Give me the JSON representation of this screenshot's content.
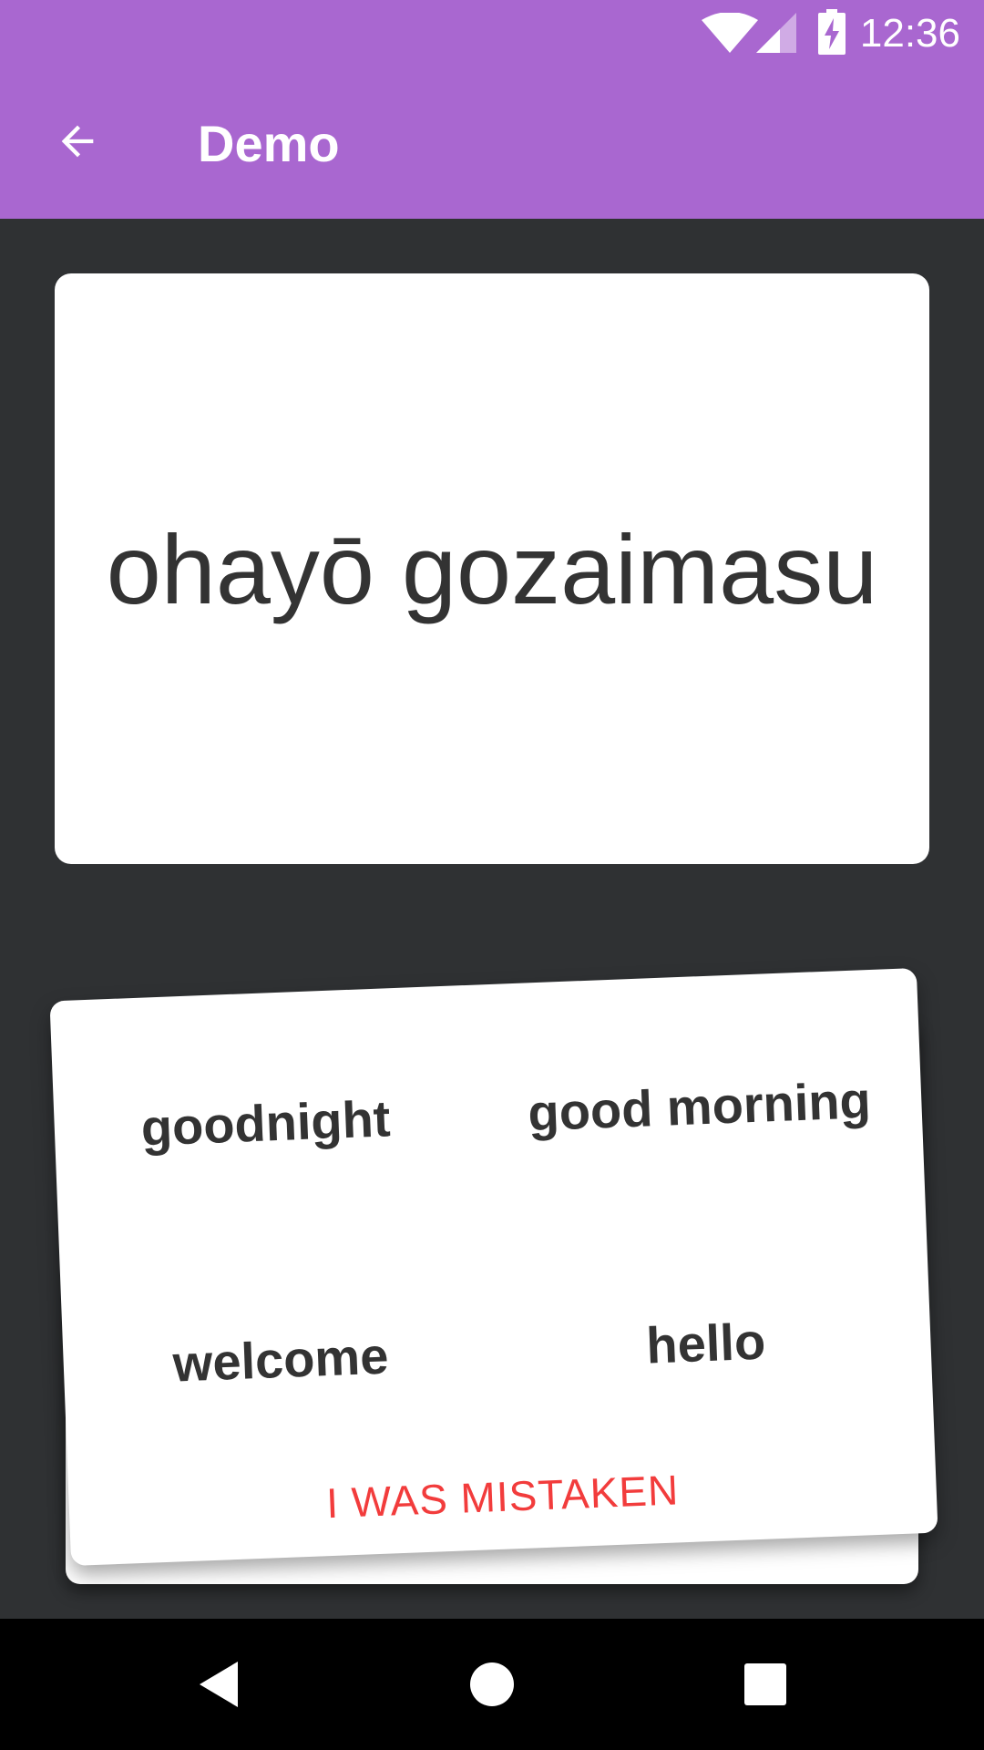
{
  "status_bar": {
    "time": "12:36",
    "icons": [
      "wifi-icon",
      "signal-icon",
      "battery-charging-icon"
    ]
  },
  "app_bar": {
    "title": "Demo",
    "back_icon": "arrow-back-icon"
  },
  "prompt": {
    "text": "ohayō gozaimasu"
  },
  "answers": {
    "options": [
      "goodnight",
      "good morning",
      "welcome",
      "hello"
    ],
    "mistake_label": "I WAS MISTAKEN"
  },
  "nav_bar": {
    "icons": [
      "nav-back-icon",
      "nav-home-icon",
      "nav-recents-icon"
    ]
  },
  "colors": {
    "app_bar": "#a967d0",
    "background": "#2f3133",
    "card": "#ffffff",
    "text": "#333333",
    "mistake": "#f23c3c",
    "nav_bar": "#000000"
  }
}
